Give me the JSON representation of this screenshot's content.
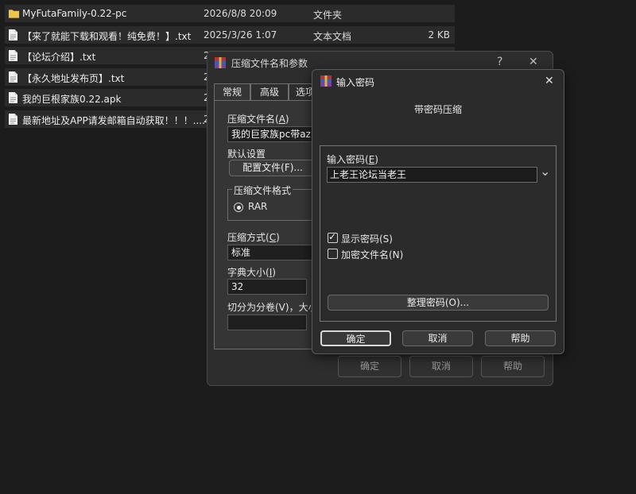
{
  "files": [
    {
      "name": "MyFutaFamily-0.22-pc",
      "date": "2026/8/8 20:09",
      "type": "文件夹",
      "size": "",
      "icon": "folder-icon"
    },
    {
      "name": "【来了就能下载和观看！纯免费！】.txt",
      "date": "2025/3/26 1:07",
      "type": "文本文档",
      "size": "2 KB",
      "icon": "text-file-icon"
    },
    {
      "name": "【论坛介绍】.txt",
      "date": "2",
      "type": "",
      "size": "",
      "icon": "text-file-icon"
    },
    {
      "name": "【永久地址发布页】.txt",
      "date": "2",
      "type": "",
      "size": "",
      "icon": "text-file-icon"
    },
    {
      "name": "我的巨根家族0.22.apk",
      "date": "2",
      "type": "",
      "size": "",
      "icon": "file-icon"
    },
    {
      "name": "最新地址及APP请发邮箱自动获取！！！....",
      "date": "2",
      "type": "",
      "size": "",
      "icon": "text-file-icon"
    }
  ],
  "archive_dialog": {
    "title": "压缩文件名和参数",
    "help_glyph": "?",
    "close_glyph": "✕",
    "tabs": [
      "常规",
      "高级",
      "选项"
    ],
    "filename_label_pre": "压缩文件名(",
    "filename_label_key": "A",
    "filename_label_post": ")",
    "filename_value": "我的巨家族pc带az.rar",
    "default_settings_label": "默认设置",
    "profiles_button": "配置文件(F)...",
    "format_group_label": "压缩文件格式",
    "format_rar": "RAR",
    "method_label_pre": "压缩方式(",
    "method_label_key": "C",
    "method_label_post": ")",
    "method_value": "标准",
    "dict_label_pre": "字典大小(",
    "dict_label_key": "I",
    "dict_label_post": ")",
    "dict_value": "32",
    "split_label": "切分为分卷(V)，大小",
    "split_value": "",
    "ok": "确定",
    "cancel": "取消",
    "help": "帮助"
  },
  "password_dialog": {
    "title": "输入密码",
    "close_glyph": "✕",
    "subtitle": "带密码压缩",
    "password_label_pre": "输入密码(",
    "password_label_key": "E",
    "password_label_post": ")",
    "password_value": "上老王论坛当老王",
    "dropdown_glyph": "⌄",
    "show_password_label": "显示密码(S)",
    "show_password_checked": true,
    "encrypt_names_label": "加密文件名(N)",
    "encrypt_names_checked": false,
    "organize_button": "整理密码(O)...",
    "ok": "确定",
    "cancel": "取消",
    "help": "帮助"
  },
  "colors": {
    "accent_folder": "#f0c54b",
    "winrar_red": "#b8322e",
    "winrar_blue": "#3a5fb0"
  }
}
